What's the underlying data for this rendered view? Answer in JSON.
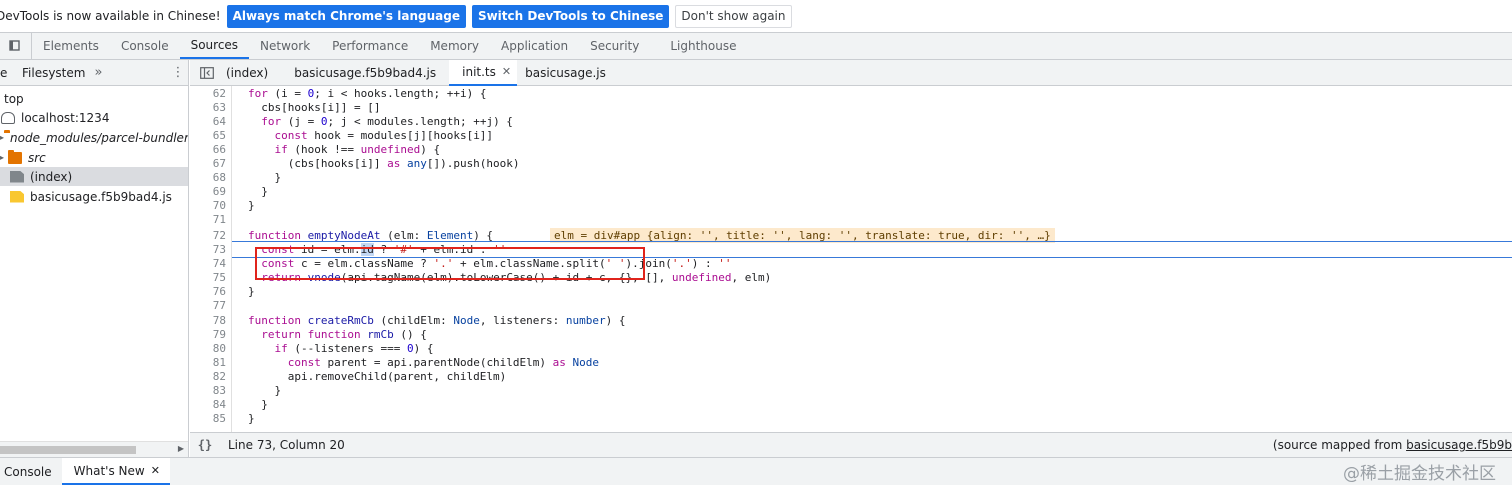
{
  "infobar": {
    "message": "DevTools is now available in Chinese!",
    "match_label": "Always match Chrome's language",
    "switch_label": "Switch DevTools to Chinese",
    "dismiss_label": "Don't show again"
  },
  "main_tabs": [
    "Elements",
    "Console",
    "Sources",
    "Network",
    "Performance",
    "Memory",
    "Application",
    "Security",
    "Lighthouse"
  ],
  "main_tabs_active": "Sources",
  "navigator": {
    "tab_page_fragment": "e",
    "tab_filesystem": "Filesystem",
    "more_label": "»",
    "menu_label": "⋮",
    "tree": [
      {
        "label": "top",
        "icon": "frame-icon"
      },
      {
        "label": "localhost:1234",
        "icon": "cloud-icon"
      },
      {
        "label": "node_modules/parcel-bundler/src",
        "icon": "folder-icon"
      },
      {
        "label": "src",
        "icon": "folder-icon"
      },
      {
        "label": "(index)",
        "icon": "file-icon"
      },
      {
        "label": "basicusage.f5b9bad4.js",
        "icon": "js-file-icon"
      }
    ]
  },
  "editor_tabs": [
    {
      "label": "(index)"
    },
    {
      "label": "basicusage.f5b9bad4.js"
    },
    {
      "label": "init.ts",
      "close": "✕"
    },
    {
      "label": "basicusage.js"
    }
  ],
  "code": {
    "line_numbers": [
      "62",
      "63",
      "64",
      "65",
      "66",
      "67",
      "68",
      "69",
      "70",
      "71",
      "72",
      "73",
      "74",
      "75",
      "76",
      "77",
      "78",
      "79",
      "80",
      "81",
      "82",
      "83",
      "84",
      "85"
    ],
    "inline_value": "elm = div#app {align: '', title: '', lang: '', translate: true, dir: '', …}"
  },
  "status": {
    "pretty_print": "{}",
    "position": "Line 73, Column 20",
    "mapped_prefix": "(source mapped from ",
    "mapped_link": "basicusage.f5b9b"
  },
  "drawer": {
    "console_label": "Console",
    "whats_new_label": "What's New",
    "close": "✕",
    "watermark": "@稀土掘金技术社区"
  },
  "colors": {
    "accent": "#1a73e8",
    "highlight_box": "#e0241c",
    "inline_value_bg": "#fde9cc"
  }
}
